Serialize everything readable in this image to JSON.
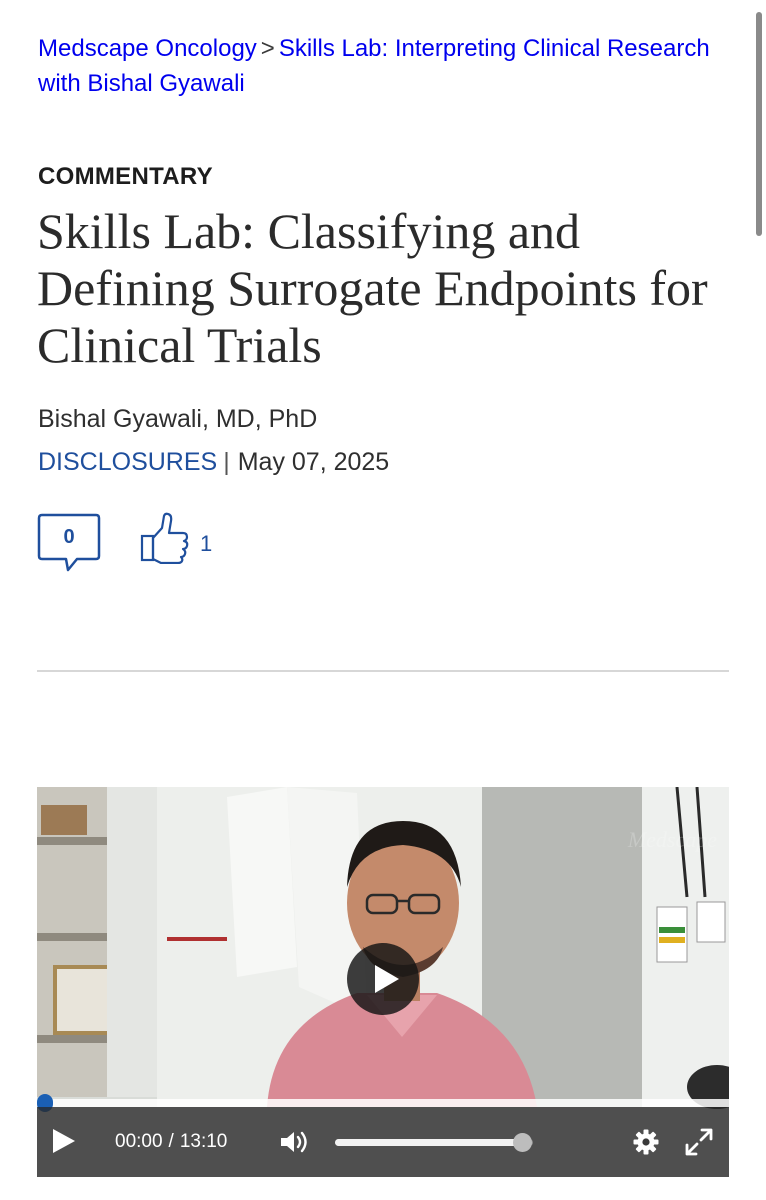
{
  "breadcrumb": {
    "section": "Medscape Oncology",
    "separator": ">",
    "series": "Skills Lab: Interpreting Clinical Research with Bishal Gyawali"
  },
  "article": {
    "kicker": "COMMENTARY",
    "title": "Skills Lab: Classifying and Defining Surrogate Endpoints for Clinical Trials",
    "author": "Bishal Gyawali, MD, PhD",
    "disclosures_label": "DISCLOSURES",
    "meta_separator": "|",
    "date": "May 07, 2025"
  },
  "engagement": {
    "comment_count": "0",
    "like_count": "1"
  },
  "video": {
    "current_time": "00:00",
    "time_separator": "/",
    "duration": "13:10",
    "progress_fraction": 0.0,
    "volume_fraction": 0.95,
    "watermark": "Medscape"
  },
  "colors": {
    "link_blue": "#1f4f9d",
    "progress_blue": "#1a5fb4",
    "text_dark": "#2b2b2b"
  },
  "icons": {
    "comment": "comment-bubble-icon",
    "like": "thumbs-up-icon",
    "play": "play-icon",
    "volume": "volume-icon",
    "settings": "gear-icon",
    "fullscreen": "fullscreen-icon"
  }
}
